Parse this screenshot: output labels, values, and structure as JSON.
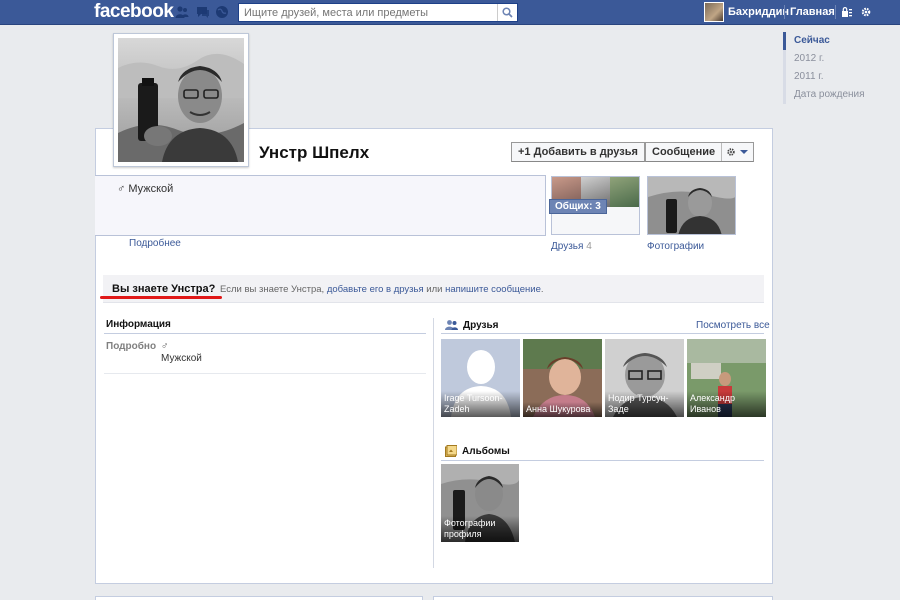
{
  "topbar": {
    "logo": "facebook",
    "search_placeholder": "Ищите друзей, места или предметы",
    "user_name": "Бахриддин",
    "home_label": "Главная"
  },
  "timeline_nav": {
    "items": [
      {
        "label": "Сейчас",
        "active": true
      },
      {
        "label": "2012 г.",
        "active": false
      },
      {
        "label": "2011 г.",
        "active": false
      },
      {
        "label": "Дата рождения",
        "active": false
      }
    ]
  },
  "profile": {
    "name": "Унстр Шпелх",
    "add_friend_label": "+1 Добавить в друзья",
    "message_label": "Сообщение",
    "gender": "Мужской",
    "more_link": "Подробнее",
    "mutual_badge": "Общих: 3",
    "friends_label": "Друзья",
    "friends_count": "4",
    "photos_label": "Фотографии"
  },
  "know_bar": {
    "question": "Вы знаете Унстра?",
    "text_before": "Если вы знаете Унстра, ",
    "add_link": "добавьте его в друзья",
    "text_middle": " или ",
    "message_link": "напишите сообщение",
    "text_after": "."
  },
  "info": {
    "title": "Информация",
    "key": "Подробно",
    "value": "Мужской"
  },
  "friends_section": {
    "title": "Друзья",
    "see_all": "Посмотреть все",
    "items": [
      {
        "name": "Irage Tursoon-Zadeh"
      },
      {
        "name": "Анна Шукурова"
      },
      {
        "name": "Нодир Турсун-Заде"
      },
      {
        "name": "Александр Иванов"
      }
    ]
  },
  "albums_section": {
    "title": "Альбомы",
    "items": [
      {
        "name": "Фотографии профиля"
      }
    ]
  },
  "colors": {
    "brand_blue": "#3b5998",
    "highlight_red": "#e01818"
  }
}
